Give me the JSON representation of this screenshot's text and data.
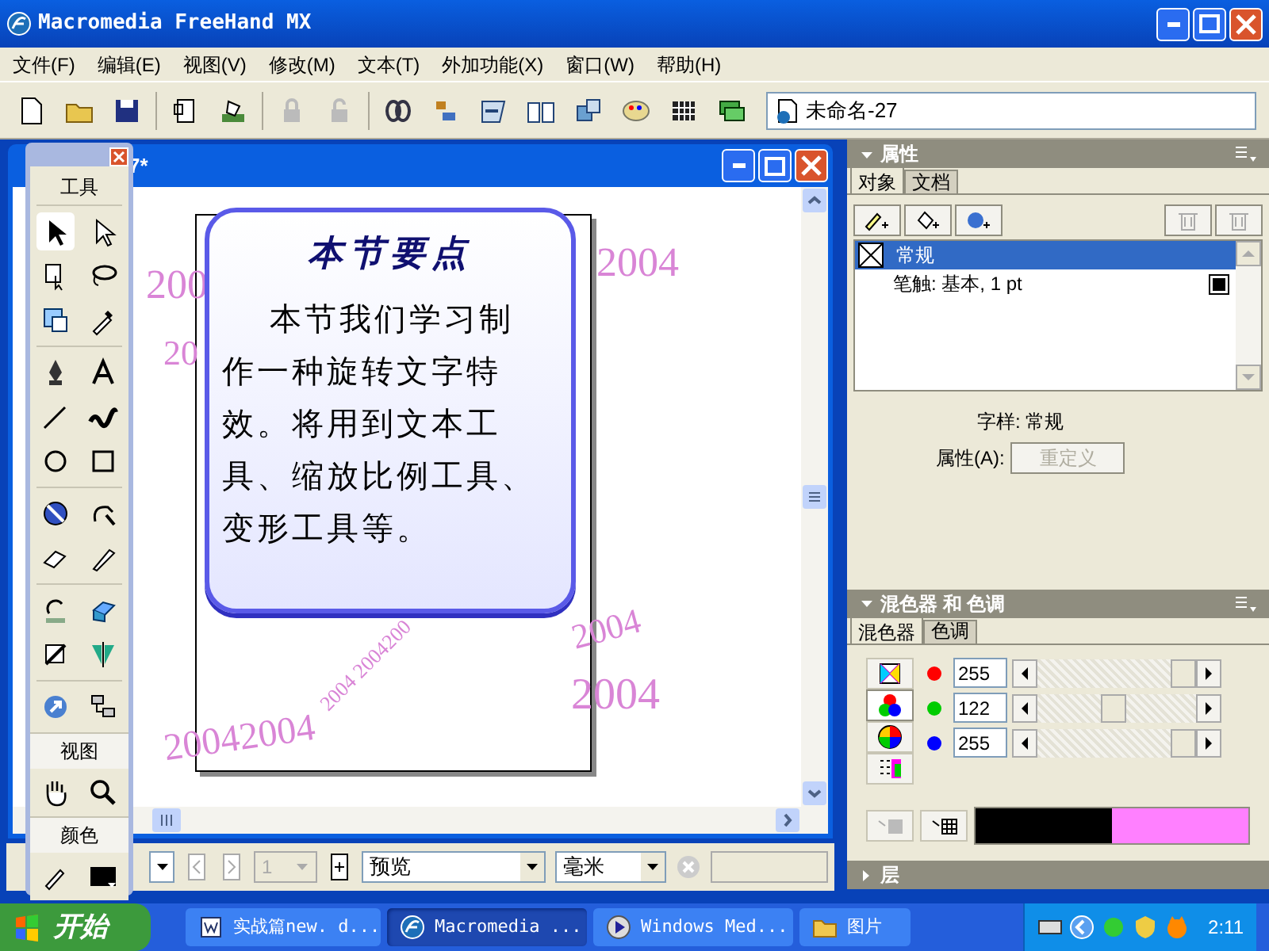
{
  "window": {
    "title": "Macromedia FreeHand MX"
  },
  "menu": [
    "文件(F)",
    "编辑(E)",
    "视图(V)",
    "修改(M)",
    "文本(T)",
    "外加功能(X)",
    "窗口(W)",
    "帮助(H)"
  ],
  "toolbar": {
    "document_field": "未命名-27"
  },
  "document": {
    "title": "7*"
  },
  "card": {
    "heading": "本节要点",
    "lines": [
      "本节我们学习制",
      "作一种旋转文字特",
      "效。将用到文本工",
      "具、缩放比例工具、",
      "变形工具等。"
    ]
  },
  "canvas_texts": [
    "200",
    "20",
    "2004",
    "2004",
    "2004",
    "20042004",
    "2004 2004200"
  ],
  "toolbox": {
    "title": "工具",
    "view_label": "视图",
    "color_label": "颜色"
  },
  "doc_status": {
    "page": "1",
    "view_mode": "预览",
    "units": "毫米"
  },
  "properties": {
    "title": "属性",
    "tabs": [
      {
        "label": "对象",
        "selected": true
      },
      {
        "label": "文档",
        "selected": false
      }
    ],
    "items": [
      {
        "label": "常规",
        "selected": true,
        "children": [
          {
            "label": "笔触: 基本, 1 pt",
            "selected": false
          }
        ]
      }
    ],
    "style_label": "字样: 常规",
    "attribute_label": "属性(A):",
    "redefine_button": "重定义",
    "redefine_disabled": true
  },
  "mixer": {
    "title": "混色器 和 色调",
    "tabs": [
      {
        "label": "混色器",
        "selected": true
      },
      {
        "label": "色调",
        "selected": false
      }
    ],
    "channels": [
      {
        "value": "255",
        "level": 1,
        "color": "#ff0000"
      },
      {
        "value": "122",
        "level": 0.48,
        "color": "#00cc00"
      },
      {
        "value": "255",
        "level": 1,
        "color": "#0000ff"
      }
    ],
    "swatches": [
      {
        "color": "#000000"
      },
      {
        "color": "#ff80ff"
      }
    ]
  },
  "layers": {
    "title": "层",
    "expanded": false
  },
  "taskbar": {
    "start": "开始",
    "tasks": [
      {
        "label": "实战篇new. d...",
        "selected": false
      },
      {
        "label": "Macromedia ...",
        "selected": true
      },
      {
        "label": "Windows Med...",
        "selected": false
      },
      {
        "label": "图片",
        "selected": false
      }
    ],
    "clock": "2:11"
  }
}
